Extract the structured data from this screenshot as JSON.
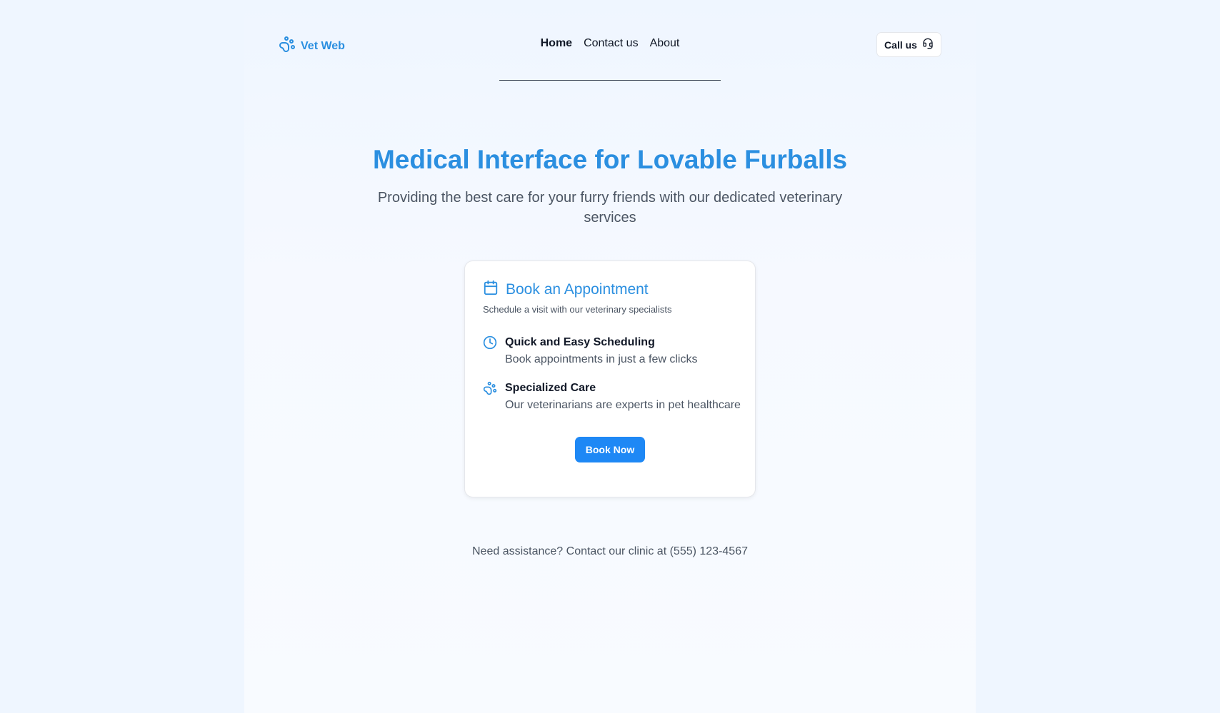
{
  "header": {
    "logo_text": "Vet Web",
    "logo_icon": "paw-icon",
    "nav": [
      {
        "label": "Home",
        "active": true
      },
      {
        "label": "Contact us",
        "active": false
      },
      {
        "label": "About",
        "active": false
      }
    ],
    "call_label": "Call us",
    "call_icon": "headset-icon"
  },
  "hero": {
    "title": "Medical Interface for Lovable Furballs",
    "subtitle": "Providing the best care for your furry friends with our dedicated veterinary services"
  },
  "card": {
    "icon": "calendar-icon",
    "title": "Book an Appointment",
    "description": "Schedule a visit with our veterinary specialists",
    "features": [
      {
        "icon": "clock-icon",
        "title": "Quick and Easy Scheduling",
        "description": "Book appointments in just a few clicks"
      },
      {
        "icon": "paw-icon",
        "title": "Specialized Care",
        "description": "Our veterinarians are experts in pet healthcare"
      }
    ],
    "button_label": "Book Now"
  },
  "footer": {
    "note": "Need assistance? Contact our clinic at (555) 123-4567"
  },
  "colors": {
    "accent": "#2b8fe0",
    "button": "#1e88f5",
    "background": "#eff6ff"
  }
}
